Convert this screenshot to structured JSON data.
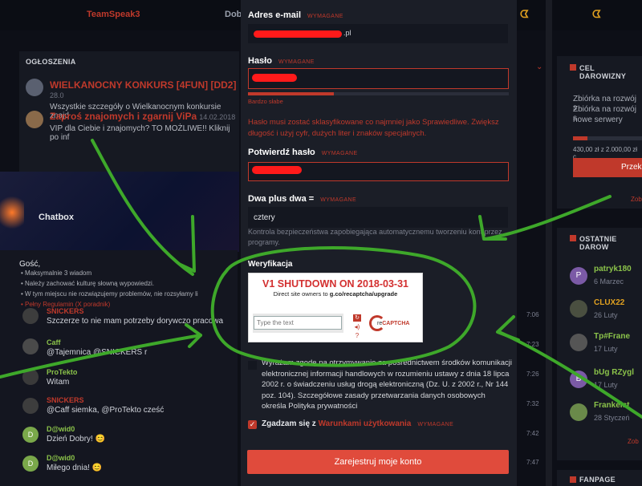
{
  "topnav": {
    "brand": "TeamSpeak3",
    "item2": "Dob"
  },
  "announcements": {
    "header": "OGŁOSZENIA",
    "items": [
      {
        "title": "WIELKANOCNY KONKURS [4FUN] [DD2]",
        "date": "28.0",
        "desc": "Wszystkie szczegóły o Wielkanocnym konkursie znajd"
      },
      {
        "title": "Zaproś znajomych i zgarnij ViPa",
        "date": "14.02.2018",
        "desc": "VIP dla Ciebie i znajomych? TO MOŻLIWE!! Kliknij po inf"
      }
    ]
  },
  "chatbox": {
    "header": "Chatbox",
    "greeting": "Gość,",
    "rules": [
      "• Maksymalnie 3 wiadom",
      "• Należy zachować kulturę słowną wypowiedzi.",
      "• W tym miejscu nie rozwiązujemy problemów, nie rozsyłamy li",
      "• Pełny Regulamin (X poradnik)"
    ],
    "messages": [
      {
        "user": "SNICKERS",
        "text": "Szczerze to nie mam potrzeby dorywczo pracowa",
        "time": "7:06"
      },
      {
        "user": "Caff",
        "text": "@Tajemnica @SNICKERS r",
        "time": "7:23"
      },
      {
        "user": "ProTekto",
        "text": "Witam",
        "time": "7:26"
      },
      {
        "user": "SNICKERS",
        "text": "@Caff siemka, @ProTekto cześć",
        "time": "7:32"
      },
      {
        "user": "D@wid0",
        "text": "Dzień Dobry! 😊",
        "time": "7:42"
      },
      {
        "user": "D@wid0",
        "text": "Miłego dnia! 😊",
        "time": "7:47"
      }
    ]
  },
  "goal": {
    "header": "CEL DAROWIZNY",
    "text": "Zbiórka na rozwój s",
    "text2": "Zbiórka na rozwój s",
    "text3": "nowe serwery",
    "amount": "430,00 zł z 2.000,00 zł c",
    "progress": 0.215,
    "button": "Przeka",
    "link": "Zobac"
  },
  "donations": {
    "header": "OSTATNIE DAROW",
    "items": [
      {
        "name": "patryk180",
        "date": "6 Marzec",
        "initial": "P"
      },
      {
        "name": "CLUX22",
        "date": "26 Luty",
        "initial": ""
      },
      {
        "name": "Tp#Frane",
        "date": "17 Luty",
        "initial": ""
      },
      {
        "name": "bUg RZygl",
        "date": "17 Luty",
        "initial": "B"
      },
      {
        "name": "Frankeist",
        "date": "28 Styczeń",
        "initial": ""
      }
    ],
    "link": "Zob"
  },
  "fanpage": {
    "header": "FANPAGE"
  },
  "form": {
    "required": "WYMAGANE",
    "email_label": "Adres e-mail",
    "email_value": ".pl",
    "password_label": "Hasło",
    "strength_label": "Bardzo słabe",
    "strength": 0.33,
    "password_hint": "Hasło musi zostać sklasyfikowane co najmniej jako Sprawiedliwe. Zwiększ długość i użyj cyfr, dużych liter i znaków specjalnych.",
    "confirm_label": "Potwierdź hasło",
    "question_label": "Dwa plus dwa =",
    "question_value": "cztery",
    "question_hint": "Kontrola bezpieczeństwa zapobiegająca automatycznemu tworzeniu kont przez programy.",
    "verify_label": "Weryfikacja",
    "captcha": {
      "title": "V1 SHUTDOWN ON 2018-03-31",
      "subtitle_prefix": "Direct site owners to ",
      "subtitle_link": "g.co/recaptcha/upgrade",
      "placeholder": "Type the text",
      "brand_prefix": "re",
      "brand": "CAPTCHA"
    },
    "consent_text": "Wyrażam zgodę na otrzymywanie za pośrednictwem środków komunikacji elektronicznej informacji handlowych w rozumieniu ustawy z dnia 18 lipca 2002 r. o świadczeniu usług drogą elektroniczną (Dz. U. z 2002 r., Nr 144 poz. 104). Szczegółowe zasady przetwarzania danych osobowych określa Polityka prywatności",
    "terms_prefix": "Zgadzam się z ",
    "terms_link": "Warunkami użytkowania",
    "submit_label": "Zarejestruj moje konto"
  },
  "colors": {
    "accent": "#c0392b",
    "button": "#e04b3c",
    "annotation": "#3ea82a",
    "redaction": "#ff1a1a"
  }
}
